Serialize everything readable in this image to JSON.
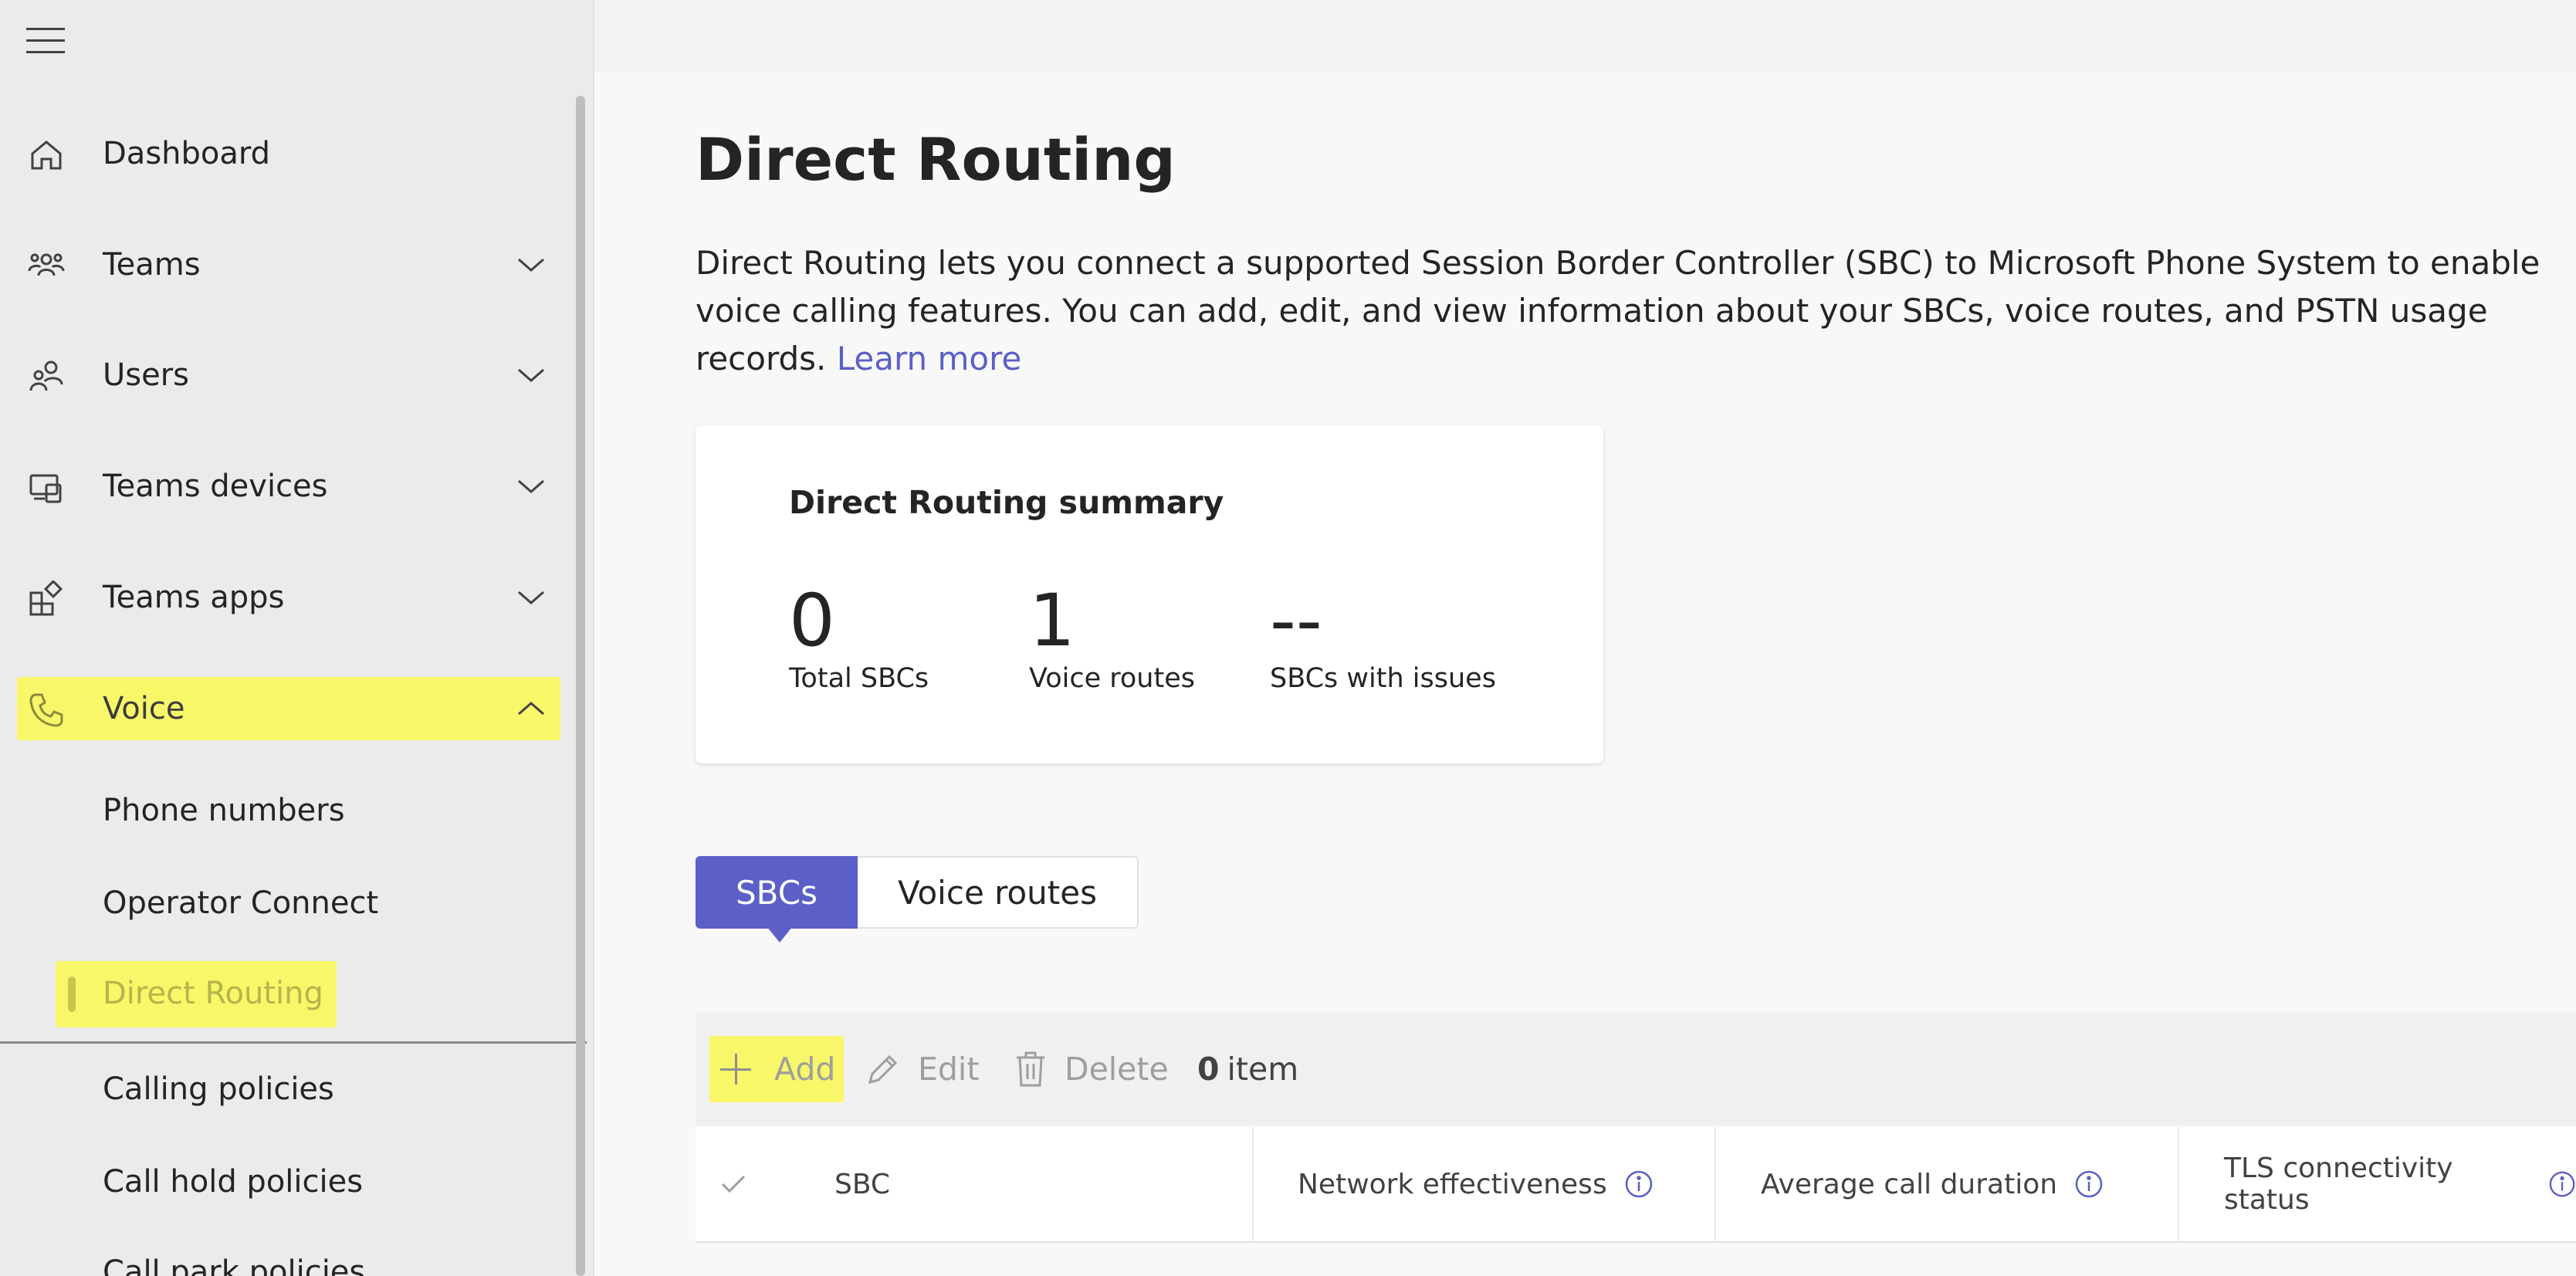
{
  "sidebar": {
    "items": [
      {
        "label": "Dashboard",
        "icon": "home-icon"
      },
      {
        "label": "Teams",
        "icon": "teams-icon"
      },
      {
        "label": "Users",
        "icon": "users-icon"
      },
      {
        "label": "Teams devices",
        "icon": "devices-icon"
      },
      {
        "label": "Teams apps",
        "icon": "apps-icon"
      },
      {
        "label": "Voice",
        "icon": "phone-icon"
      }
    ],
    "voice_subitems": [
      "Phone numbers",
      "Operator Connect",
      "Direct Routing",
      "Calling policies",
      "Call hold policies",
      "Call park policies"
    ]
  },
  "main": {
    "title": "Direct Routing",
    "description": "Direct Routing lets you connect a supported Session Border Controller (SBC) to Microsoft Phone System to enable voice calling features. You can add, edit, and view information about your SBCs, voice routes, and PSTN usage records.",
    "learn_more": "Learn more",
    "summary": {
      "title": "Direct Routing summary",
      "stats": [
        {
          "value": "0",
          "caption": "Total SBCs"
        },
        {
          "value": "1",
          "caption": "Voice routes"
        },
        {
          "value": "--",
          "caption": "SBCs with issues"
        }
      ]
    },
    "tabs": [
      "SBCs",
      "Voice routes"
    ],
    "toolbar": {
      "add": "Add",
      "edit": "Edit",
      "delete": "Delete",
      "count": "0",
      "count_unit": "item"
    },
    "table": {
      "columns": [
        "SBC",
        "Network effectiveness",
        "Average call duration",
        "TLS connectivity status"
      ]
    }
  },
  "colors": {
    "accent": "#5b5fc7",
    "highlight": "#f8f76a",
    "sidebar_bg": "#ebebeb"
  }
}
